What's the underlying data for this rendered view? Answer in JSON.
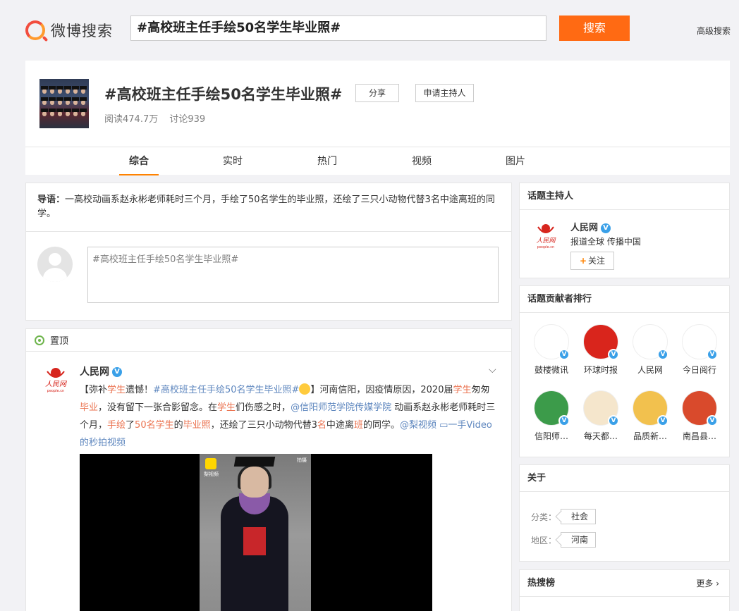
{
  "header": {
    "logo_text": "微博搜索",
    "search_value": "#高校班主任手绘50名学生毕业照#",
    "search_button": "搜索",
    "advanced_search": "高级搜索"
  },
  "topic": {
    "title": "#高校班主任手绘50名学生毕业照#",
    "share_label": "分享",
    "apply_host_label": "申请主持人",
    "reads": "阅读474.7万",
    "discussions": "讨论939",
    "tabs": [
      "综合",
      "实时",
      "热门",
      "视频",
      "图片"
    ],
    "active_tab": "综合"
  },
  "intro": {
    "lead_label": "导语：",
    "lead_text": "一高校动画系赵永彬老师耗时三个月，手绘了50名学生的毕业照，还绘了三只小动物代替3名中途离班的同学。",
    "compose_placeholder": "#高校班主任手绘50名学生毕业照#"
  },
  "feed": {
    "pinned_label": "置顶",
    "post": {
      "author": "人民网",
      "segments": [
        {
          "t": "【弥补",
          "c": ""
        },
        {
          "t": "学生",
          "c": "hl"
        },
        {
          "t": "遗憾！",
          "c": ""
        },
        {
          "t": "#高校班主任手绘50名学生毕业照#",
          "c": "lk"
        },
        {
          "t": "EMOJI",
          "c": "emoji"
        },
        {
          "t": "】河南信阳，因疫情原因，2020届",
          "c": ""
        },
        {
          "t": "学生",
          "c": "hl"
        },
        {
          "t": "匆匆",
          "c": ""
        },
        {
          "t": "毕业",
          "c": "hl"
        },
        {
          "t": "，没有留下一张合影留念。在",
          "c": ""
        },
        {
          "t": "学生",
          "c": "hl"
        },
        {
          "t": "们伤感之时，",
          "c": ""
        },
        {
          "t": "@信阳师范学院传媒学院",
          "c": "lk"
        },
        {
          "t": " 动画系赵永彬老师耗时三个月，",
          "c": ""
        },
        {
          "t": "手绘",
          "c": "hl"
        },
        {
          "t": "了",
          "c": ""
        },
        {
          "t": "50名学生",
          "c": "hl"
        },
        {
          "t": "的",
          "c": ""
        },
        {
          "t": "毕业照",
          "c": "hl"
        },
        {
          "t": "，还绘了三只小动物代替3",
          "c": ""
        },
        {
          "t": "名",
          "c": "hl"
        },
        {
          "t": "中途离",
          "c": ""
        },
        {
          "t": "班",
          "c": "hl"
        },
        {
          "t": "的同学。",
          "c": ""
        },
        {
          "t": "@梨视频",
          "c": "lk"
        },
        {
          "t": " ",
          "c": ""
        },
        {
          "t": "▭一手Video的秒拍视频",
          "c": "lk"
        }
      ],
      "video_logo_text": "梨视频",
      "video_corner_text": "拍摄"
    }
  },
  "sidebar": {
    "host": {
      "title": "话题主持人",
      "name": "人民网",
      "desc": "报道全球 传播中国",
      "follow_label": "关注"
    },
    "ranking": {
      "title": "话题贡献者排行",
      "items": [
        {
          "name": "鼓楼微讯",
          "color": "#ffffff"
        },
        {
          "name": "环球时报",
          "color": "#d9251c"
        },
        {
          "name": "人民网",
          "color": "#ffffff"
        },
        {
          "name": "今日阅行",
          "color": "#ffffff"
        },
        {
          "name": "信阳师…",
          "color": "#3c9b4a"
        },
        {
          "name": "每天都…",
          "color": "#f5e6cc"
        },
        {
          "name": "品质新…",
          "color": "#f2c14e"
        },
        {
          "name": "南昌县…",
          "color": "#d94a2c"
        }
      ]
    },
    "about": {
      "title": "关于",
      "category_label": "分类：",
      "category_value": "社会",
      "region_label": "地区：",
      "region_value": "河南"
    },
    "hot": {
      "title": "热搜榜",
      "more_label": "更多"
    }
  }
}
